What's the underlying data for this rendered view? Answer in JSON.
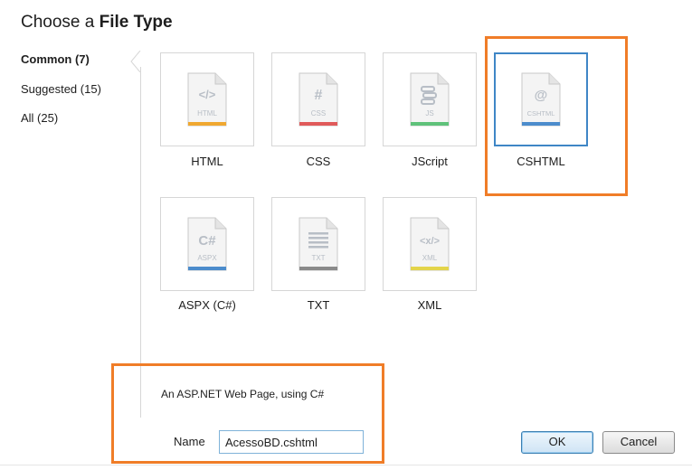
{
  "dialog": {
    "title_prefix": "Choose a ",
    "title_bold": "File Type"
  },
  "categories": [
    {
      "label": "Common (7)",
      "selected": true
    },
    {
      "label": "Suggested (15)",
      "selected": false
    },
    {
      "label": "All (25)",
      "selected": false
    }
  ],
  "file_types": [
    {
      "label": "HTML",
      "icon_text": "HTML",
      "glyph": "</>",
      "stripe_color": "#f0a830",
      "selected": false
    },
    {
      "label": "CSS",
      "icon_text": "CSS",
      "glyph": "#",
      "stripe_color": "#e05a5a",
      "selected": false
    },
    {
      "label": "JScript",
      "icon_text": "JS",
      "glyph": "script",
      "stripe_color": "#5fc27a",
      "selected": false
    },
    {
      "label": "CSHTML",
      "icon_text": "CSHTML",
      "glyph": "@",
      "stripe_color": "#4c8ccc",
      "selected": true
    },
    {
      "label": "ASPX (C#)",
      "icon_text": "ASPX",
      "glyph": "C#",
      "stripe_color": "#4c8ccc",
      "selected": false
    },
    {
      "label": "TXT",
      "icon_text": "TXT",
      "glyph": "lines",
      "stripe_color": "#8a8a8a",
      "selected": false
    },
    {
      "label": "XML",
      "icon_text": "XML",
      "glyph": "<x/>",
      "stripe_color": "#e3d44a",
      "selected": false
    }
  ],
  "description": "An ASP.NET Web Page, using C#",
  "name_field": {
    "label": "Name",
    "value": "AcessoBD.cshtml"
  },
  "buttons": {
    "ok": "OK",
    "cancel": "Cancel"
  },
  "colors": {
    "callout": "#f07d28",
    "selection": "#3f86c6"
  }
}
